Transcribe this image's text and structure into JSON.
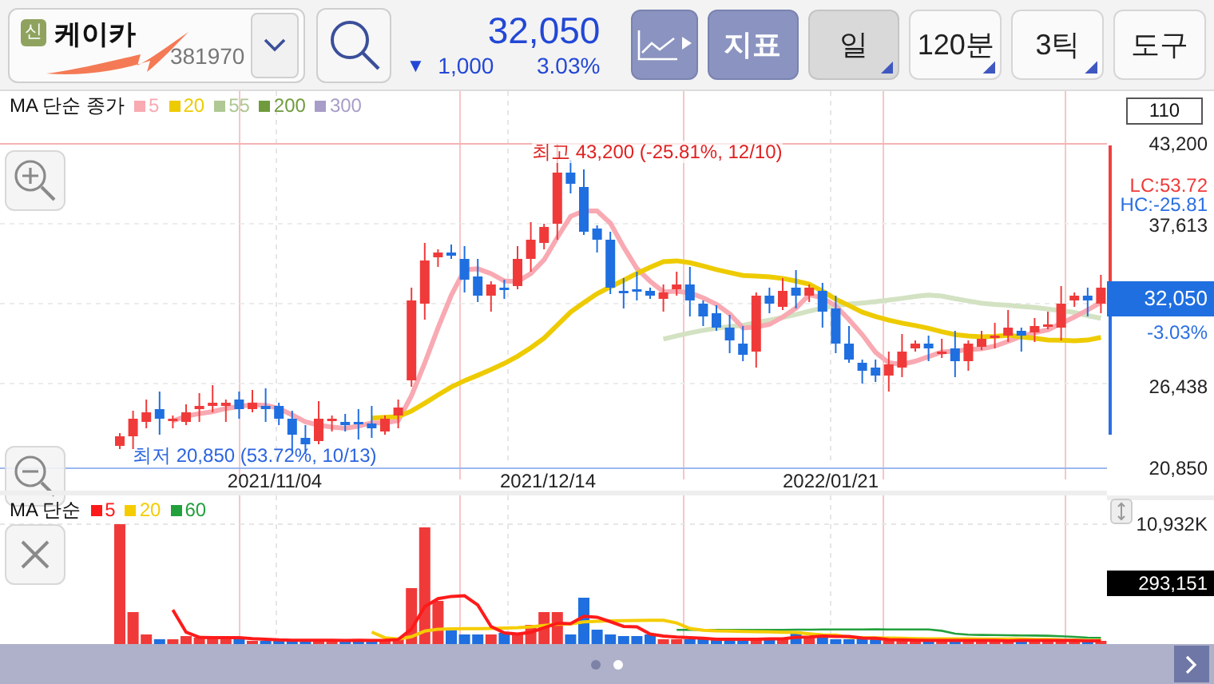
{
  "header": {
    "badge": "신",
    "name": "케이카",
    "code": "381970",
    "price": "32,050",
    "change_arrow": "▼",
    "change": "1,000",
    "change_pct": "3.03%"
  },
  "toolbar": [
    {
      "kind": "chart-type",
      "selected": false,
      "dropdown": false
    },
    {
      "kind": "accent",
      "label": "지표",
      "selected": false,
      "dropdown": false
    },
    {
      "kind": "plain",
      "label": "일",
      "selected": true,
      "dropdown": true
    },
    {
      "kind": "plain",
      "label": "120분",
      "selected": false,
      "dropdown": true
    },
    {
      "kind": "plain",
      "label": "3틱",
      "selected": false,
      "dropdown": true
    },
    {
      "kind": "plain",
      "label": "도구",
      "selected": false,
      "dropdown": false
    }
  ],
  "price_chart": {
    "legend_title": "MA 단순 종가",
    "ma_legend": [
      {
        "label": "5",
        "color": "#f8a9b2"
      },
      {
        "label": "20",
        "color": "#eecb00"
      },
      {
        "label": "55",
        "color": "#afc894"
      },
      {
        "label": "200",
        "color": "#6f9b3c"
      },
      {
        "label": "300",
        "color": "#a89cc8"
      }
    ],
    "scale_box": "110",
    "y_labels": [
      "43,200",
      "37,613",
      "26,438",
      "20,850"
    ],
    "current_price": "32,050",
    "current_change": "-3.03%",
    "lc": "LC:53.72",
    "hc": "HC:-25.81",
    "high_note": "최고 43,200 (-25.81%, 12/10)",
    "low_note": "최저 20,850 (53.72%, 10/13)",
    "x_labels": [
      "2021/11/04",
      "2021/12/14",
      "2022/01/21"
    ]
  },
  "volume_chart": {
    "legend_title": "MA 단순",
    "ma_legend": [
      {
        "label": "5",
        "color": "#ff1a1a"
      },
      {
        "label": "20",
        "color": "#f5cc00"
      },
      {
        "label": "60",
        "color": "#22a03c"
      }
    ],
    "max_label": "10,932K",
    "current_volume": "293,151"
  },
  "pager": [
    {
      "selected": false
    },
    {
      "selected": true
    }
  ]
}
